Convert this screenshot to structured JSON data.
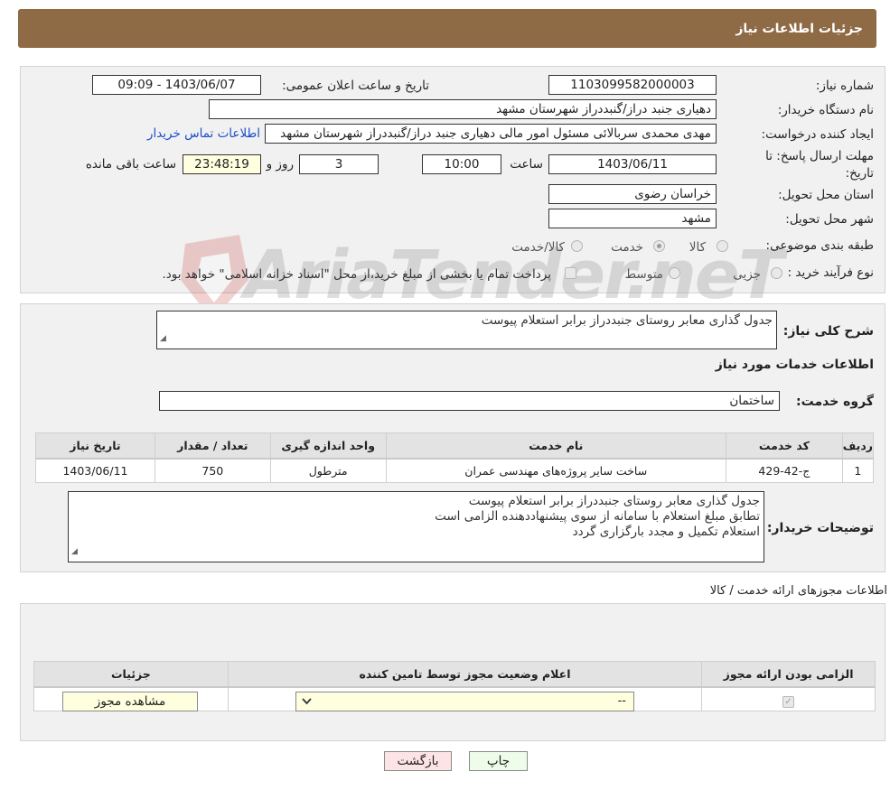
{
  "header": {
    "title": "جزئیات اطلاعات نیاز"
  },
  "form": {
    "need_number_label": "شماره نیاز:",
    "need_number": "1103099582000003",
    "announce_label": "تاریخ و ساعت اعلان عمومی:",
    "announce_value": "1403/06/07 - 09:09",
    "buyer_org_label": "نام دستگاه خریدار:",
    "buyer_org": "دهیاری جنبد دراز/گنبددراز شهرستان مشهد",
    "creator_label": "ایجاد کننده درخواست:",
    "creator": "مهدی محمدی سربالائی مسئول امور مالی دهیاری جنبد دراز/گنبددراز شهرستان مشهد",
    "contact_link": "اطلاعات تماس خریدار",
    "deadline_label": "مهلت ارسال پاسخ: تا تاریخ:",
    "deadline_date": "1403/06/11",
    "hour_label": "ساعت",
    "deadline_time": "10:00",
    "days_value": "3",
    "days_label": "روز و",
    "remaining_time": "23:48:19",
    "remaining_label": "ساعت باقی مانده",
    "province_label": "استان محل تحویل:",
    "province": "خراسان رضوی",
    "city_label": "شهر محل تحویل:",
    "city": "مشهد",
    "category_label": "طبقه بندی موضوعی:",
    "category_options": [
      "کالا",
      "خدمت",
      "کالا/خدمت"
    ],
    "category_selected": "خدمت",
    "process_label": "نوع فرآیند خرید :",
    "process_options": [
      "جزیی",
      "متوسط"
    ],
    "payment_note": "پرداخت تمام یا بخشی از مبلغ خرید،از محل \"اسناد خزانه اسلامی\" خواهد بود."
  },
  "watermark": {
    "text": "AriaTender.neT"
  },
  "details": {
    "summary_label": "شرح کلی نیاز:",
    "summary": "جدول گذاری معابر روستای جنبددراز برابر استعلام پیوست",
    "services_heading": "اطلاعات خدمات مورد نیاز",
    "service_group_label": "گروه خدمت:",
    "service_group": "ساختمان",
    "table": {
      "headers": [
        "ردیف",
        "کد خدمت",
        "نام خدمت",
        "واحد اندازه گیری",
        "تعداد / مقدار",
        "تاریخ نیاز"
      ],
      "rows": [
        [
          "1",
          "ج-42-429",
          "ساخت سایر پروژه‌های مهندسی عمران",
          "مترطول",
          "750",
          "1403/06/11"
        ]
      ]
    },
    "buyer_notes_label": "توضیحات خریدار:",
    "buyer_notes": [
      "جدول گذاری معابر روستای جنبددراز برابر استعلام پیوست",
      "تطابق مبلغ استعلام با سامانه از سوی پیشنهاددهنده الزامی است",
      "استعلام تکمیل و مجدد بارگزاری گردد"
    ]
  },
  "permits": {
    "heading": "اطلاعات مجوزهای ارائه خدمت / کالا",
    "headers": [
      "الزامی بودن ارائه مجوز",
      "اعلام وضعیت مجوز توسط تامین کننده",
      "جزئیات"
    ],
    "select_value": "--",
    "view_button": "مشاهده مجوز"
  },
  "actions": {
    "print": "چاپ",
    "back": "بازگشت"
  }
}
